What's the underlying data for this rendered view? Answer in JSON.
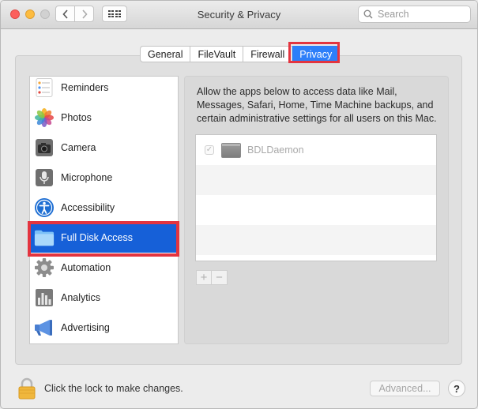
{
  "window": {
    "title": "Security & Privacy",
    "search_placeholder": "Search"
  },
  "tabs": [
    {
      "label": "General",
      "selected": false
    },
    {
      "label": "FileVault",
      "selected": false
    },
    {
      "label": "Firewall",
      "selected": false
    },
    {
      "label": "Privacy",
      "selected": true
    }
  ],
  "sidebar": {
    "items": [
      {
        "label": "Reminders",
        "icon": "reminders-icon"
      },
      {
        "label": "Photos",
        "icon": "photos-icon"
      },
      {
        "label": "Camera",
        "icon": "camera-icon"
      },
      {
        "label": "Microphone",
        "icon": "microphone-icon"
      },
      {
        "label": "Accessibility",
        "icon": "accessibility-icon"
      },
      {
        "label": "Full Disk Access",
        "icon": "folder-icon",
        "selected": true
      },
      {
        "label": "Automation",
        "icon": "gear-icon"
      },
      {
        "label": "Analytics",
        "icon": "analytics-icon"
      },
      {
        "label": "Advertising",
        "icon": "megaphone-icon"
      }
    ]
  },
  "content": {
    "description": "Allow the apps below to access data like Mail, Messages, Safari, Home, Time Machine backups, and certain administrative settings for all users on this Mac.",
    "apps": [
      {
        "name": "BDLDaemon",
        "checked": true
      }
    ],
    "add_label": "+",
    "remove_label": "−"
  },
  "footer": {
    "lock_text": "Click the lock to make changes.",
    "advanced_label": "Advanced...",
    "help_label": "?"
  },
  "colors": {
    "accent": "#2d7ff9",
    "selection": "#1660d8",
    "highlight_box": "#e3343f"
  }
}
